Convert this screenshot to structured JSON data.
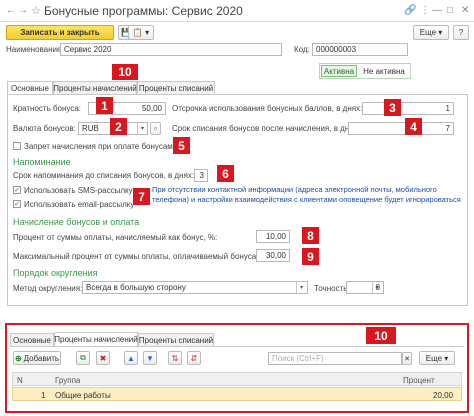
{
  "window": {
    "title": "Бонусные программы: Сервис 2020",
    "star": "☆",
    "icons": {
      "link": "🔗",
      "menu": "⋮",
      "minimize": "—",
      "maximize": "□",
      "close": "✕",
      "back": "←",
      "forward": "→"
    }
  },
  "toolbar": {
    "save_close": "Записать и закрыть",
    "save_icon": "💾",
    "doc_icon": "📋 ▾",
    "more": "Еще ▾",
    "help": "?"
  },
  "header": {
    "name_label": "Наименование:",
    "name_value": "Сервис 2020",
    "code_label": "Код:",
    "code_value": "000000003",
    "status_active": "Активна",
    "status_inactive": "Не активна"
  },
  "tabs": [
    {
      "label": "Основные"
    },
    {
      "label": "Проценты начислений"
    },
    {
      "label": "Проценты списаний"
    }
  ],
  "main": {
    "multiplicity_label": "Кратность бонуса:",
    "multiplicity_value": "50,00",
    "currency_label": "Валюта бонусов:",
    "currency_value": "RUB",
    "deferral_label": "Отсрочка использования бонусных баллов, в днях:",
    "deferral_value": "1",
    "writeoff_label": "Срок списания бонусов после начисления, в днях:",
    "writeoff_value": "7",
    "forbid_label": "Запрет начисления при оплате бонусами",
    "reminder_section": "Напоминание",
    "reminder_label": "Срок напоминания до списания бонусов, в днях:",
    "reminder_value": "3",
    "sms_label": "Использовать SMS-рассылку",
    "email_label": "Использовать email-рассылку",
    "info_text": "При отсутствии контактной информации (адреса электронной почты, мобильного телефона) и настройки взаимодействия с клиентами оповещение будет игнорироваться",
    "accrual_section": "Начисление бонусов и оплата",
    "percent_accrual_label": "Процент от суммы оплаты, начисляемый как бонус, %:",
    "percent_accrual_value": "10,00",
    "max_percent_label": "Максимальный процент от суммы оплаты, оплачиваемый бонусами, %:",
    "max_percent_value": "30,00",
    "rounding_section": "Порядок округления",
    "rounding_method_label": "Метод округления:",
    "rounding_method_value": "Всегда в большую сторону",
    "precision_label": "Точность:",
    "precision_value": "0"
  },
  "bottom": {
    "tabs": [
      {
        "label": "Основные"
      },
      {
        "label": "Проценты начислений"
      },
      {
        "label": "Проценты списаний"
      }
    ],
    "add_label": "Добавить",
    "search_placeholder": "Поиск (Ctrl+F)",
    "more": "Еще ▾",
    "columns": [
      "N",
      "Группа",
      "Процент"
    ],
    "rows": [
      {
        "n": "1",
        "group": "Общие работы",
        "percent": "20,00"
      }
    ]
  },
  "badges": [
    "1",
    "2",
    "3",
    "4",
    "5",
    "6",
    "7",
    "8",
    "9",
    "10",
    "10"
  ],
  "colors": {
    "badge": "#d7191f",
    "primary": "#f4ce2a",
    "section": "#3a9a4a",
    "info": "#1a4fa0",
    "row_selected": "#fbeec0"
  }
}
